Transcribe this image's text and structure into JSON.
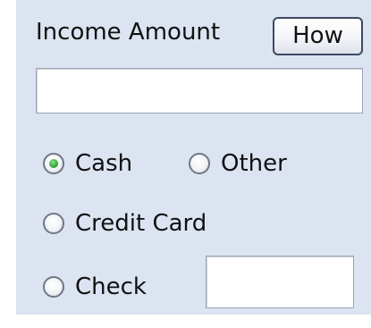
{
  "form": {
    "title": "Income Amount",
    "how_button_label": "How",
    "amount_value": "",
    "payment_methods": [
      {
        "label": "Cash",
        "selected": true
      },
      {
        "label": "Other",
        "selected": false
      },
      {
        "label": "Credit Card",
        "selected": false
      },
      {
        "label": "Check",
        "selected": false
      }
    ],
    "check_number_value": ""
  },
  "colors": {
    "panel_background": "#dce4f2",
    "radio_selected": "#34a834",
    "button_border": "#3d4a63"
  }
}
